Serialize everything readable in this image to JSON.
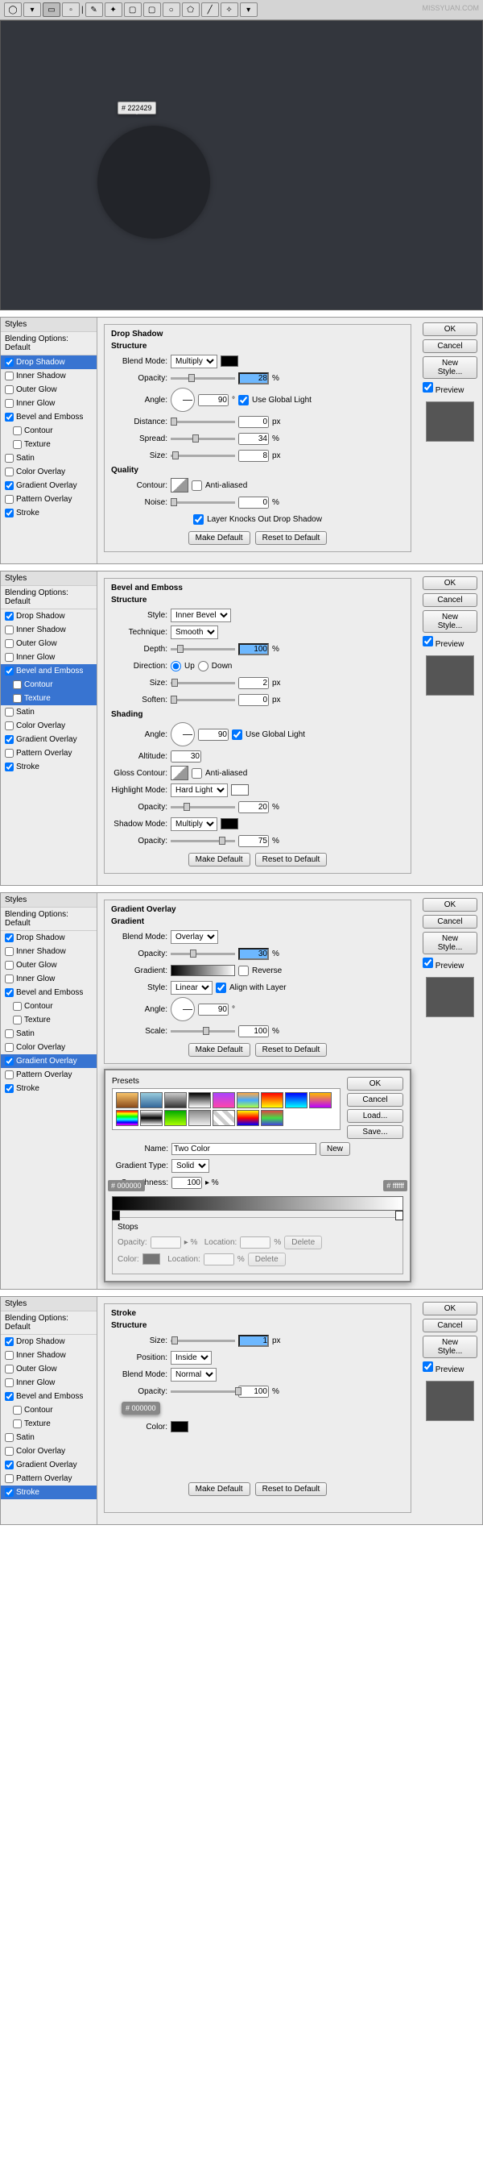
{
  "watermark": "MISSYUAN.COM",
  "canvas": {
    "color_tag": "# 222429"
  },
  "toolbar_icons": [
    "ellipse",
    "arrow",
    "marquee",
    "rect",
    "lasso",
    "wand",
    "crop",
    "text",
    "shape",
    "ellipse2",
    "pen",
    "brush",
    "more"
  ],
  "panels": [
    {
      "title": "Drop Shadow",
      "styles_header": "Styles",
      "blending": "Blending Options: Default",
      "items": [
        {
          "label": "Drop Shadow",
          "checked": true,
          "selected": true
        },
        {
          "label": "Inner Shadow",
          "checked": false
        },
        {
          "label": "Outer Glow",
          "checked": false
        },
        {
          "label": "Inner Glow",
          "checked": false
        },
        {
          "label": "Bevel and Emboss",
          "checked": true
        },
        {
          "label": "Contour",
          "checked": false,
          "sub": true
        },
        {
          "label": "Texture",
          "checked": false,
          "sub": true
        },
        {
          "label": "Satin",
          "checked": false
        },
        {
          "label": "Color Overlay",
          "checked": false
        },
        {
          "label": "Gradient Overlay",
          "checked": true
        },
        {
          "label": "Pattern Overlay",
          "checked": false
        },
        {
          "label": "Stroke",
          "checked": true
        }
      ],
      "structure": {
        "blend_mode_label": "Blend Mode:",
        "blend_mode": "Multiply",
        "opacity_label": "Opacity:",
        "opacity": "28",
        "opacity_unit": "%",
        "angle_label": "Angle:",
        "angle": "90",
        "angle_unit": "°",
        "global_light": "Use Global Light",
        "global_checked": true,
        "distance_label": "Distance:",
        "distance": "0",
        "dist_unit": "px",
        "spread_label": "Spread:",
        "spread": "34",
        "spread_unit": "%",
        "size_label": "Size:",
        "size": "8",
        "size_unit": "px"
      },
      "quality": {
        "title": "Quality",
        "contour_label": "Contour:",
        "antialiased": "Anti-aliased",
        "noise_label": "Noise:",
        "noise": "0",
        "noise_unit": "%",
        "knockout": "Layer Knocks Out Drop Shadow",
        "knockout_checked": true
      },
      "btns": {
        "make_default": "Make Default",
        "reset": "Reset to Default"
      },
      "right": {
        "ok": "OK",
        "cancel": "Cancel",
        "new_style": "New Style...",
        "preview": "Preview",
        "preview_checked": true
      }
    },
    {
      "title": "Bevel and Emboss",
      "styles_header": "Styles",
      "blending": "Blending Options: Default",
      "items": [
        {
          "label": "Drop Shadow",
          "checked": true
        },
        {
          "label": "Inner Shadow",
          "checked": false
        },
        {
          "label": "Outer Glow",
          "checked": false
        },
        {
          "label": "Inner Glow",
          "checked": false
        },
        {
          "label": "Bevel and Emboss",
          "checked": true,
          "selected": true
        },
        {
          "label": "Contour",
          "checked": false,
          "sub": true,
          "selected": true
        },
        {
          "label": "Texture",
          "checked": false,
          "sub": true,
          "selected": true
        },
        {
          "label": "Satin",
          "checked": false
        },
        {
          "label": "Color Overlay",
          "checked": false
        },
        {
          "label": "Gradient Overlay",
          "checked": true
        },
        {
          "label": "Pattern Overlay",
          "checked": false
        },
        {
          "label": "Stroke",
          "checked": true
        }
      ],
      "structure": {
        "style_label": "Style:",
        "style": "Inner Bevel",
        "technique_label": "Technique:",
        "technique": "Smooth",
        "depth_label": "Depth:",
        "depth": "100",
        "depth_unit": "%",
        "direction_label": "Direction:",
        "up": "Up",
        "down": "Down",
        "up_checked": true,
        "size_label": "Size:",
        "size": "2",
        "size_unit": "px",
        "soften_label": "Soften:",
        "soften": "0",
        "soften_unit": "px"
      },
      "shading": {
        "title": "Shading",
        "angle_label": "Angle:",
        "angle": "90",
        "global_light": "Use Global Light",
        "global_checked": true,
        "altitude_label": "Altitude:",
        "altitude": "30",
        "gloss_label": "Gloss Contour:",
        "antialiased": "Anti-aliased",
        "highlight_label": "Highlight Mode:",
        "highlight": "Hard Light",
        "h_opacity_label": "Opacity:",
        "h_opacity": "20",
        "h_unit": "%",
        "shadow_label": "Shadow Mode:",
        "shadow": "Multiply",
        "s_opacity_label": "Opacity:",
        "s_opacity": "75",
        "s_unit": "%"
      },
      "btns": {
        "make_default": "Make Default",
        "reset": "Reset to Default"
      },
      "right": {
        "ok": "OK",
        "cancel": "Cancel",
        "new_style": "New Style...",
        "preview": "Preview",
        "preview_checked": true
      }
    },
    {
      "title": "Gradient Overlay",
      "styles_header": "Styles",
      "blending": "Blending Options: Default",
      "items": [
        {
          "label": "Drop Shadow",
          "checked": true
        },
        {
          "label": "Inner Shadow",
          "checked": false
        },
        {
          "label": "Outer Glow",
          "checked": false
        },
        {
          "label": "Inner Glow",
          "checked": false
        },
        {
          "label": "Bevel and Emboss",
          "checked": true
        },
        {
          "label": "Contour",
          "checked": false,
          "sub": true
        },
        {
          "label": "Texture",
          "checked": false,
          "sub": true
        },
        {
          "label": "Satin",
          "checked": false
        },
        {
          "label": "Color Overlay",
          "checked": false
        },
        {
          "label": "Gradient Overlay",
          "checked": true,
          "selected": true
        },
        {
          "label": "Pattern Overlay",
          "checked": false
        },
        {
          "label": "Stroke",
          "checked": true
        }
      ],
      "gradient": {
        "subtitle": "Gradient",
        "blend_mode_label": "Blend Mode:",
        "blend_mode": "Overlay",
        "opacity_label": "Opacity:",
        "opacity": "30",
        "opacity_unit": "%",
        "gradient_label": "Gradient:",
        "reverse": "Reverse",
        "style_label": "Style:",
        "style": "Linear",
        "align": "Align with Layer",
        "align_checked": true,
        "angle_label": "Angle:",
        "angle": "90",
        "angle_unit": "°",
        "scale_label": "Scale:",
        "scale": "100",
        "scale_unit": "%"
      },
      "btns": {
        "make_default": "Make Default",
        "reset": "Reset to Default"
      },
      "editor": {
        "presets_label": "Presets",
        "name_label": "Name:",
        "name": "Two Color",
        "new_btn": "New",
        "type_label": "Gradient Type:",
        "type": "Solid",
        "smooth_label": "Smoothness:",
        "smooth": "100",
        "smooth_unit": "%",
        "stop_left": "# 000000",
        "stop_right": "# ffffff",
        "stops_title": "Stops",
        "s_opacity": "Opacity:",
        "s_location": "Location:",
        "s_unit": "%",
        "s_delete": "Delete",
        "s_color": "Color:",
        "right": {
          "ok": "OK",
          "cancel": "Cancel",
          "load": "Load...",
          "save": "Save..."
        }
      },
      "right": {
        "ok": "OK",
        "cancel": "Cancel",
        "new_style": "New Style...",
        "preview": "Preview",
        "preview_checked": true
      }
    },
    {
      "title": "Stroke",
      "styles_header": "Styles",
      "blending": "Blending Options: Default",
      "items": [
        {
          "label": "Drop Shadow",
          "checked": true
        },
        {
          "label": "Inner Shadow",
          "checked": false
        },
        {
          "label": "Outer Glow",
          "checked": false
        },
        {
          "label": "Inner Glow",
          "checked": false
        },
        {
          "label": "Bevel and Emboss",
          "checked": true
        },
        {
          "label": "Contour",
          "checked": false,
          "sub": true
        },
        {
          "label": "Texture",
          "checked": false,
          "sub": true
        },
        {
          "label": "Satin",
          "checked": false
        },
        {
          "label": "Color Overlay",
          "checked": false
        },
        {
          "label": "Gradient Overlay",
          "checked": true
        },
        {
          "label": "Pattern Overlay",
          "checked": false
        },
        {
          "label": "Stroke",
          "checked": true,
          "selected": true
        }
      ],
      "structure": {
        "size_label": "Size:",
        "size": "1",
        "size_unit": "px",
        "position_label": "Position:",
        "position": "Inside",
        "blend_mode_label": "Blend Mode:",
        "blend_mode": "Normal",
        "opacity_label": "Opacity:",
        "opacity": "100",
        "opacity_unit": "%",
        "color_label": "Color:",
        "color_tag": "# 000000"
      },
      "btns": {
        "make_default": "Make Default",
        "reset": "Reset to Default"
      },
      "right": {
        "ok": "OK",
        "cancel": "Cancel",
        "new_style": "New Style...",
        "preview": "Preview",
        "preview_checked": true
      }
    }
  ],
  "gradient_presets": [
    "linear-gradient(#f7c36a,#8a4a1a)",
    "linear-gradient(#9cd,#369)",
    "linear-gradient(#ccc,#333)",
    "linear-gradient(#000,#fff)",
    "linear-gradient(#a4f,#f4a)",
    "linear-gradient(#fa4,#4af,#af4)",
    "linear-gradient(#f00,#ff0)",
    "linear-gradient(#00f,#0ff)",
    "linear-gradient(#fb0,#b0f)",
    "linear-gradient(#f00,#ff0,#0f0,#0ff,#00f,#f0f)",
    "linear-gradient(#fff,#000,#fff)",
    "linear-gradient(#0a0,#af0)",
    "linear-gradient(#888,#eee)",
    "repeating-linear-gradient(45deg,#ccc 0 5px,#fff 5px 10px)",
    "linear-gradient(#ff0,#f00,#00f)",
    "linear-gradient(#d44,#4d4,#44d)"
  ]
}
